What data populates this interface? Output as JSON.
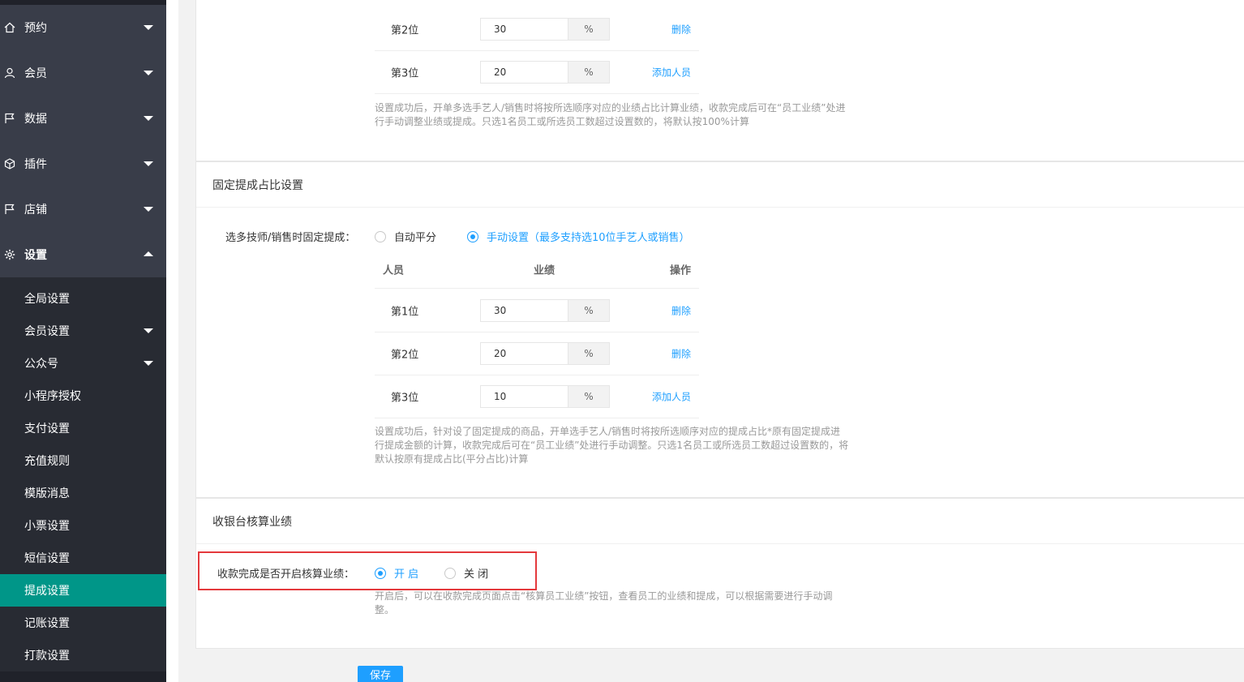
{
  "sidebar": {
    "menus": [
      {
        "label": "预约",
        "icon": "home-icon"
      },
      {
        "label": "会员",
        "icon": "user-icon"
      },
      {
        "label": "数据",
        "icon": "flag-icon"
      },
      {
        "label": "插件",
        "icon": "cube-icon"
      },
      {
        "label": "店铺",
        "icon": "flag-icon"
      },
      {
        "label": "设置",
        "icon": "gear-icon"
      }
    ],
    "submenu": [
      {
        "label": "全局设置"
      },
      {
        "label": "会员设置"
      },
      {
        "label": "公众号"
      },
      {
        "label": "小程序授权"
      },
      {
        "label": "支付设置"
      },
      {
        "label": "充值规则"
      },
      {
        "label": "模版消息"
      },
      {
        "label": "小票设置"
      },
      {
        "label": "短信设置"
      },
      {
        "label": "提成设置"
      },
      {
        "label": "记账设置"
      },
      {
        "label": "打款设置"
      }
    ],
    "active_color": "#009688"
  },
  "section1": {
    "rows": [
      {
        "pos": "第2位",
        "value": "30",
        "unit": "%",
        "action": "删除"
      },
      {
        "pos": "第3位",
        "value": "20",
        "unit": "%",
        "action": "添加人员"
      }
    ],
    "note_line1": "设置成功后，开单多选手艺人/销售时将按所选顺序对应的业绩占比计算业绩，收款完成后可在“员工业绩”处进",
    "note_line2": "行手动调整业绩或提成。只选1名员工或所选员工数超过设置数的，将默认按100%计算"
  },
  "section2": {
    "title": "固定提成占比设置",
    "label": "选多技师/销售时固定提成：",
    "option_auto": "自动平分",
    "option_manual": "手动设置（最多支持选10位手艺人或销售）",
    "headers": {
      "person": "人员",
      "performance": "业绩",
      "action": "操作"
    },
    "rows": [
      {
        "pos": "第1位",
        "value": "30",
        "unit": "%",
        "action": "删除"
      },
      {
        "pos": "第2位",
        "value": "20",
        "unit": "%",
        "action": "删除"
      },
      {
        "pos": "第3位",
        "value": "10",
        "unit": "%",
        "action": "添加人员"
      }
    ],
    "note_line1": "设置成功后，针对设了固定提成的商品，开单选手艺人/销售时将按所选顺序对应的提成占比*原有固定提成进",
    "note_line2": "行提成金额的计算，收款完成后可在“员工业绩”处进行手动调整。只选1名员工或所选员工数超过设置数的，将",
    "note_line3": "默认按原有提成占比(平分占比)计算"
  },
  "section3": {
    "title": "收银台核算业绩",
    "label": "收款完成是否开启核算业绩：",
    "option_on": "开 启",
    "option_off": "关 闭",
    "note_line1": "开启后，可以在收款完成页面点击“核算员工业绩”按钮，查看员工的业绩和提成，可以根据需要进行手动调",
    "note_line2": "整。"
  },
  "save_label": "保存",
  "accent_color": "#1e9fff",
  "highlight_color": "#e4393c"
}
